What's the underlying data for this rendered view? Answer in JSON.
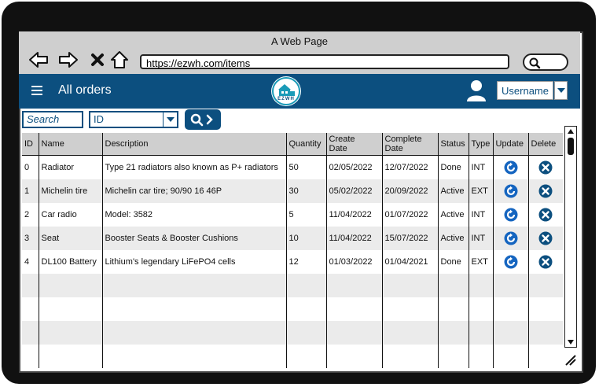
{
  "window": {
    "title": "A Web Page"
  },
  "browser": {
    "url": "https://ezwh.com/items"
  },
  "appbar": {
    "title": "All orders",
    "logo_text": "EZWH",
    "username": "Username"
  },
  "toolbar": {
    "search_placeholder": "Search",
    "filter_value": "ID"
  },
  "table": {
    "headers": {
      "id": "ID",
      "name": "Name",
      "description": "Description",
      "quantity": "Quantity",
      "create_date": "Create\nDate",
      "complete_date": "Complete\nDate",
      "status": "Status",
      "type": "Type",
      "update": "Update",
      "delete": "Delete"
    },
    "rows": [
      {
        "id": "0",
        "name": "Radiator",
        "description": "Type 21 radiators also known as P+ radiators",
        "quantity": "50",
        "create_date": "02/05/2022",
        "complete_date": "12/07/2022",
        "status": "Done",
        "type": "INT"
      },
      {
        "id": "1",
        "name": "Michelin tire",
        "description": "Michelin car tire;  90/90 16  46P",
        "quantity": "30",
        "create_date": "05/02/2022",
        "complete_date": "20/09/2022",
        "status": "Active",
        "type": "EXT"
      },
      {
        "id": "2",
        "name": "Car radio",
        "description": "Model: 3582",
        "quantity": "5",
        "create_date": "11/04/2022",
        "complete_date": "01/07/2022",
        "status": "Active",
        "type": "INT"
      },
      {
        "id": "3",
        "name": "Seat",
        "description": "Booster Seats & Booster Cushions",
        "quantity": "10",
        "create_date": "11/04/2022",
        "complete_date": "15/07/2022",
        "status": "Active",
        "type": "INT"
      },
      {
        "id": "4",
        "name": "DL100 Battery",
        "description": "Lithium's legendary LiFePO4 cells",
        "quantity": "12",
        "create_date": "01/03/2022",
        "complete_date": "01/04/2021",
        "status": "Done",
        "type": "EXT"
      }
    ],
    "empty_rows": 4
  },
  "colors": {
    "accent": "#0c4f7f",
    "update_icon": "#1565c0",
    "delete_icon": "#0c4f7f"
  },
  "icons": [
    "back-arrow-icon",
    "forward-arrow-icon",
    "close-icon",
    "home-icon",
    "search-icon",
    "menu-icon",
    "user-icon",
    "chevron-down-icon",
    "refresh-icon",
    "delete-circle-icon"
  ]
}
